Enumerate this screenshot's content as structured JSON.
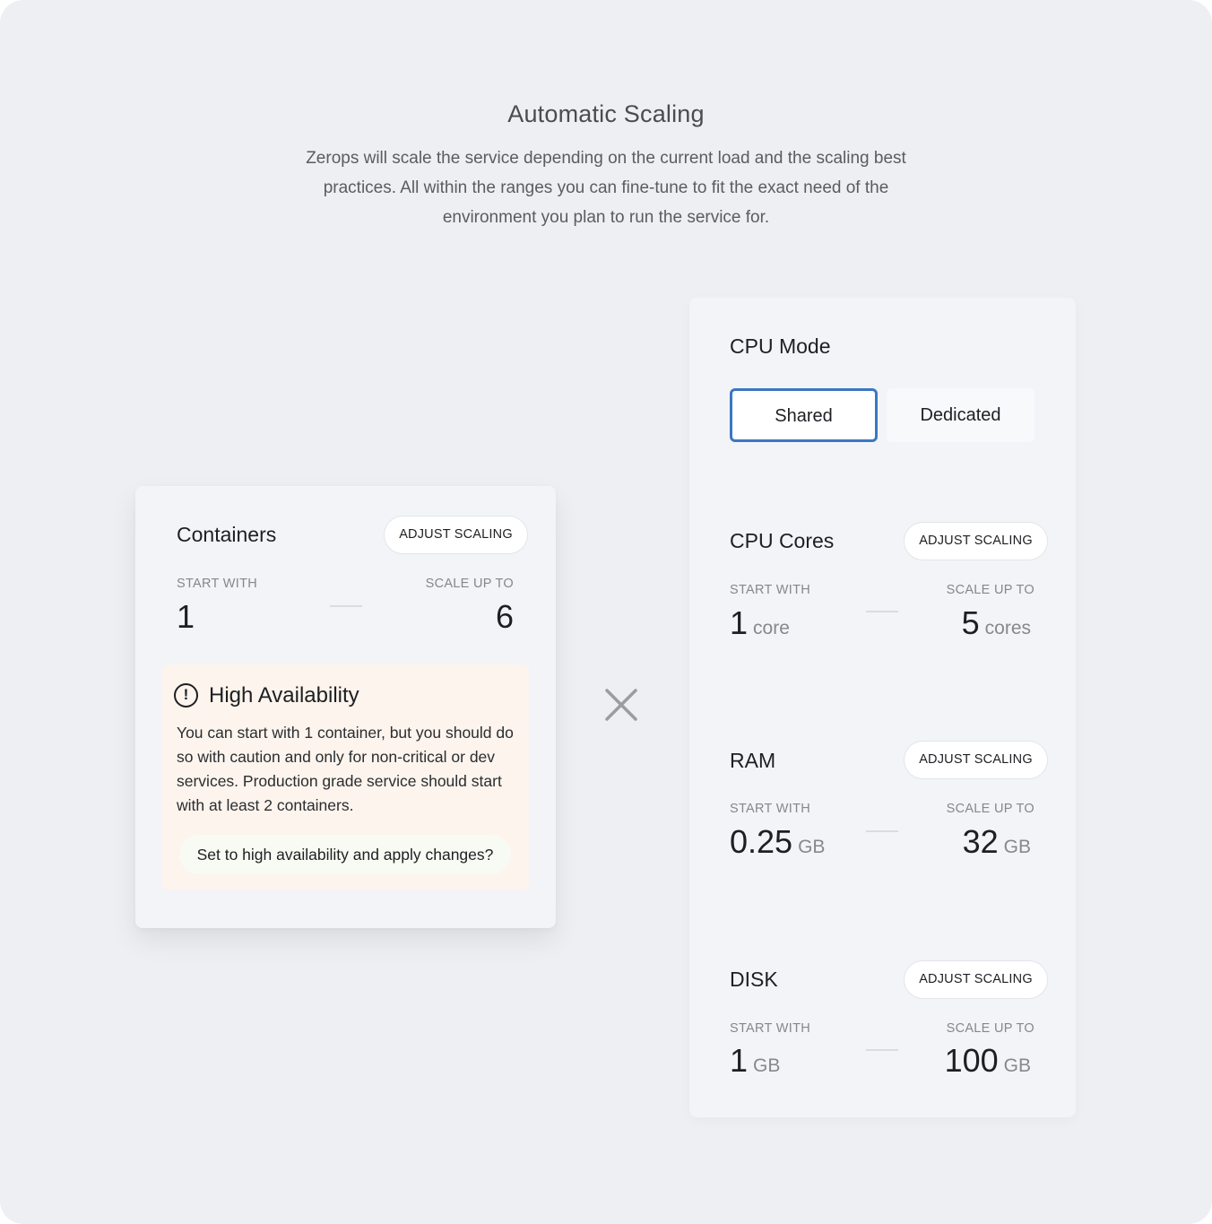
{
  "hero": {
    "title": "Automatic Scaling",
    "description": "Zerops will scale the service depending on the current load and the scaling best practices. All within the ranges you can fine-tune to fit the exact need of the environment you plan to run the service for."
  },
  "containers": {
    "title": "Containers",
    "adjust_label": "ADJUST SCALING",
    "start_label": "START WITH",
    "scale_label": "SCALE UP TO",
    "start_value": "1",
    "scale_value": "6",
    "high_availability": {
      "icon": "exclamation-circle-icon",
      "title": "High Availability",
      "text": "You can start with 1 container, but you should do so with caution and only for non-critical or dev services. Production grade service should start with at least 2 containers.",
      "action_label": "Set to high availability and apply changes?"
    }
  },
  "separator_icon": "multiply-icon",
  "resources": {
    "cpu_mode": {
      "title": "CPU Mode",
      "options": [
        "Shared",
        "Dedicated"
      ],
      "selected": "Shared",
      "accent_color": "#3a78c2"
    },
    "sections": [
      {
        "title": "CPU Cores",
        "adjust_label": "ADJUST SCALING",
        "start_label": "START WITH",
        "scale_label": "SCALE UP TO",
        "start_value": "1",
        "start_unit": "core",
        "scale_value": "5",
        "scale_unit": "cores"
      },
      {
        "title": "RAM",
        "adjust_label": "ADJUST SCALING",
        "start_label": "START WITH",
        "scale_label": "SCALE UP TO",
        "start_value": "0.25",
        "start_unit": "GB",
        "scale_value": "32",
        "scale_unit": "GB"
      },
      {
        "title": "DISK",
        "adjust_label": "ADJUST SCALING",
        "start_label": "START WITH",
        "scale_label": "SCALE UP TO",
        "start_value": "1",
        "start_unit": "GB",
        "scale_value": "100",
        "scale_unit": "GB"
      }
    ]
  }
}
